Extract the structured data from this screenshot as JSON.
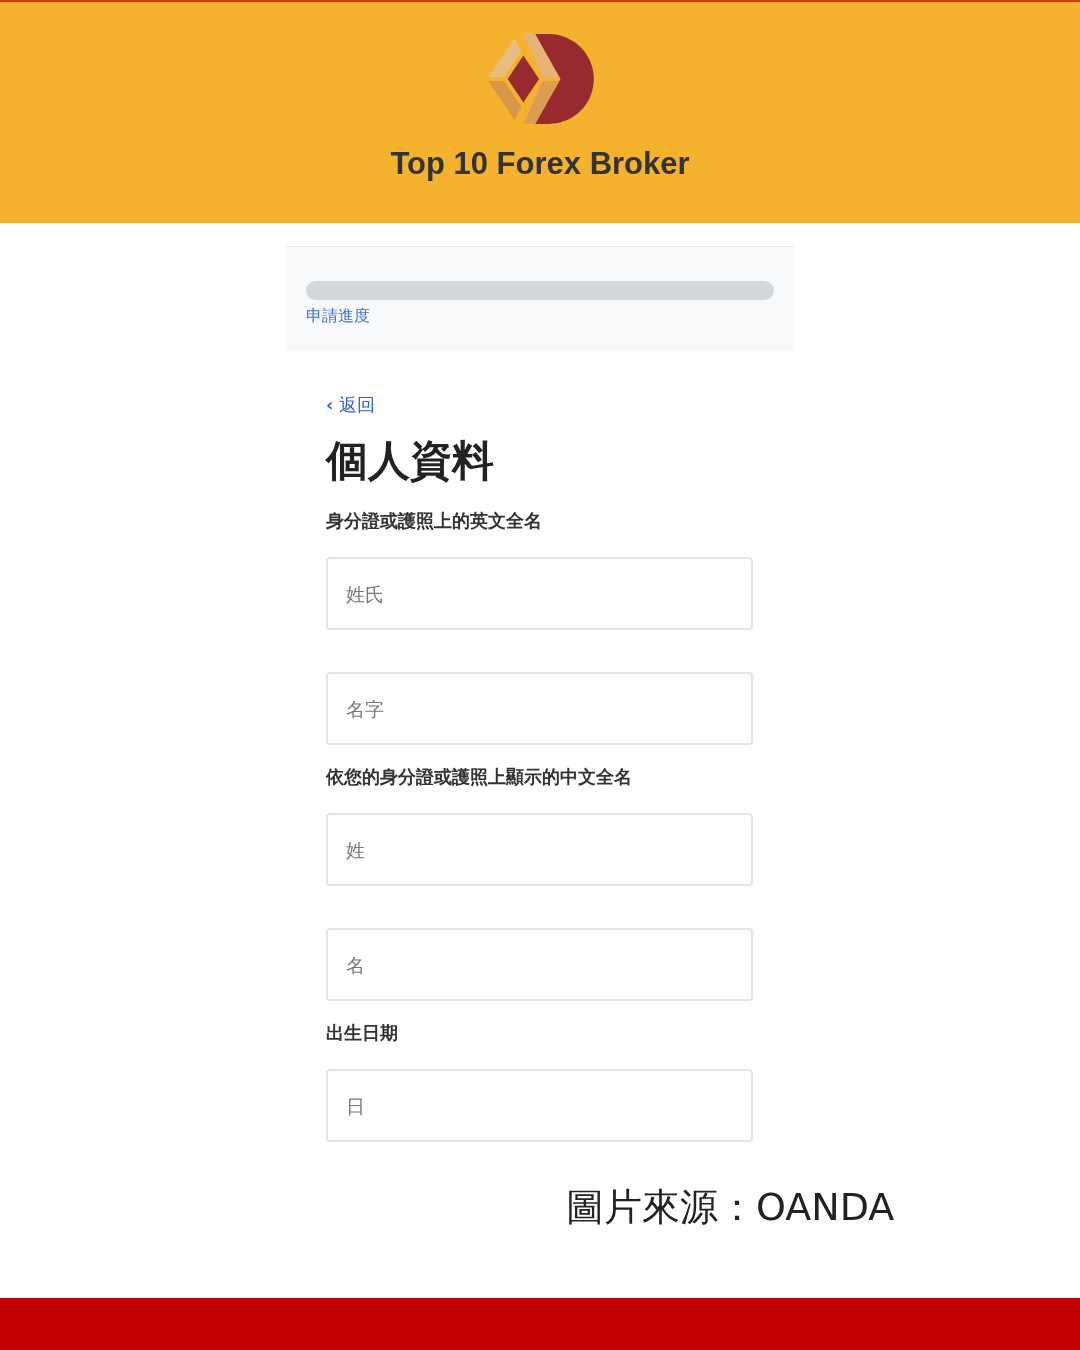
{
  "brand": {
    "name": "Top 10 Forex Broker"
  },
  "progress": {
    "label": "申請進度",
    "level": 0
  },
  "back_link": {
    "icon": "‹",
    "label": "返回"
  },
  "heading": "個人資料",
  "sections": [
    {
      "label": "身分證或護照上的英文全名",
      "fields": [
        {
          "placeholder": "姓氏"
        },
        {
          "placeholder": "名字"
        }
      ]
    },
    {
      "label": "依您的身分證或護照上顯示的中文全名",
      "fields": [
        {
          "placeholder": "姓"
        },
        {
          "placeholder": "名"
        }
      ]
    },
    {
      "label": "出生日期",
      "fields": [
        {
          "placeholder": "日"
        }
      ]
    }
  ],
  "caption": "圖片來源：OANDA"
}
